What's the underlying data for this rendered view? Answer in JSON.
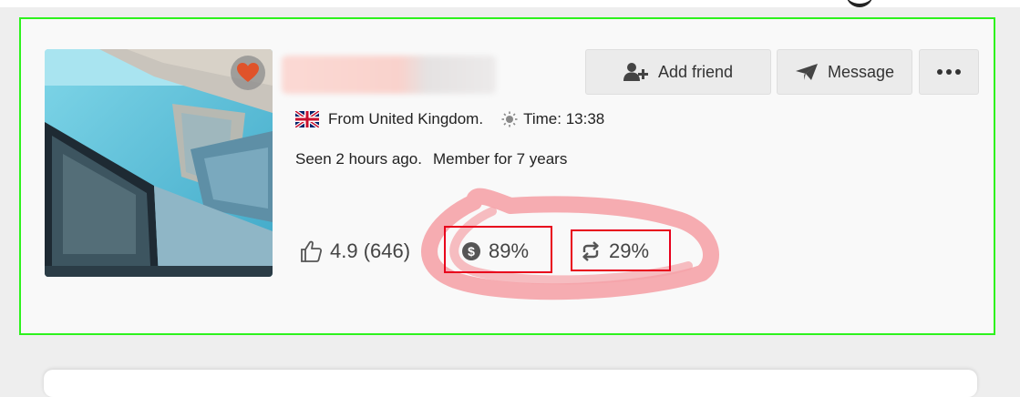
{
  "profile": {
    "origin_text": "From United Kingdom.",
    "time_label": "Time:",
    "time_value": "13:38",
    "seen_text": "Seen 2 hours ago.",
    "member_text": "Member for 7 years",
    "rating": "4.9 (646)",
    "paid_rate": "89%",
    "repeat_rate": "29%"
  },
  "actions": {
    "add_friend_label": "Add friend",
    "message_label": "Message"
  },
  "icons": {
    "favorite": "heart-icon",
    "add_friend": "user-plus-icon",
    "message": "paper-plane-icon",
    "more": "ellipsis-icon",
    "flag": "uk-flag-icon",
    "time": "sun-icon",
    "rating": "thumbs-up-icon",
    "paid": "dollar-circle-icon",
    "repeat": "repeat-icon"
  },
  "colors": {
    "card_outline": "#2df21d",
    "annotation_box": "#e8001c",
    "annotation_scribble": "#f5a3a8",
    "heart": "#e0532a"
  }
}
